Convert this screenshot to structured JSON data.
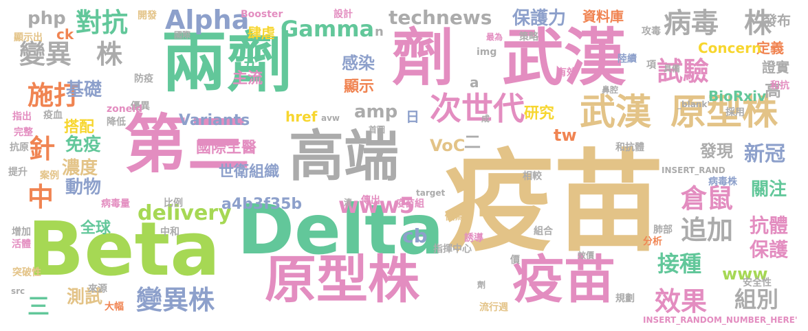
{
  "palette": {
    "tan": "#E3C387",
    "pink": "#E38DC0",
    "green": "#62C79A",
    "lime": "#A6D854",
    "orange": "#F08452",
    "blue": "#8DA0CB",
    "gray": "#ABABAB",
    "yellow": "#F7D62F"
  },
  "words": [
    {
      "text": "疫苗",
      "color": "tan"
    },
    {
      "text": "Beta",
      "color": "lime"
    },
    {
      "text": "Delta",
      "color": "green"
    },
    {
      "text": "原型株",
      "color": "pink"
    },
    {
      "text": "疫苗",
      "color": "pink"
    },
    {
      "text": "第三",
      "color": "pink"
    },
    {
      "text": "高端",
      "color": "gray"
    },
    {
      "text": "兩劑",
      "color": "green"
    },
    {
      "text": "劑",
      "color": "pink"
    },
    {
      "text": "武漢",
      "color": "pink"
    },
    {
      "text": "武漢",
      "color": "tan"
    },
    {
      "text": "原型株",
      "color": "tan"
    },
    {
      "text": "次世代",
      "color": "pink"
    },
    {
      "text": "變異",
      "color": "gray"
    },
    {
      "text": "株",
      "color": "gray"
    },
    {
      "text": "變異株",
      "color": "blue"
    },
    {
      "text": "病毒",
      "color": "gray"
    },
    {
      "text": "株",
      "color": "gray"
    },
    {
      "text": "Alpha",
      "color": "blue"
    },
    {
      "text": "Gamma",
      "color": "green"
    },
    {
      "text": "n",
      "color": "gray"
    },
    {
      "text": "technews",
      "color": "gray"
    },
    {
      "text": "對抗",
      "color": "green"
    },
    {
      "text": "施打",
      "color": "orange"
    },
    {
      "text": "基礎",
      "color": "blue"
    },
    {
      "text": "針",
      "color": "orange"
    },
    {
      "text": "免疫",
      "color": "green"
    },
    {
      "text": "中",
      "color": "orange"
    },
    {
      "text": "動物",
      "color": "blue"
    },
    {
      "text": "濃度",
      "color": "tan"
    },
    {
      "text": "delivery",
      "color": "lime"
    },
    {
      "text": "www5",
      "color": "pink"
    },
    {
      "text": "試驗",
      "color": "pink"
    },
    {
      "text": "倉鼠",
      "color": "pink"
    },
    {
      "text": "追加",
      "color": "gray"
    },
    {
      "text": "接種",
      "color": "green"
    },
    {
      "text": "效果",
      "color": "pink"
    },
    {
      "text": "組別",
      "color": "gray"
    },
    {
      "text": "測試",
      "color": "tan"
    },
    {
      "text": "三",
      "color": "green"
    },
    {
      "text": "保護力",
      "color": "blue"
    },
    {
      "text": "資料庫",
      "color": "orange"
    },
    {
      "text": "發布",
      "color": "gray"
    },
    {
      "text": "定義",
      "color": "orange"
    },
    {
      "text": "證實",
      "color": "gray"
    },
    {
      "text": "高",
      "color": "gray"
    },
    {
      "text": "新冠",
      "color": "blue"
    },
    {
      "text": "發現",
      "color": "gray"
    },
    {
      "text": "關注",
      "color": "green"
    },
    {
      "text": "抗體",
      "color": "pink"
    },
    {
      "text": "保護",
      "color": "pink"
    },
    {
      "text": "www",
      "color": "lime"
    },
    {
      "text": "cb",
      "color": "blue"
    },
    {
      "text": "Concern",
      "color": "yellow"
    },
    {
      "text": "BioRxiv",
      "color": "green"
    },
    {
      "text": "php",
      "color": "gray"
    },
    {
      "text": "ck",
      "color": "orange"
    },
    {
      "text": "五",
      "color": "green"
    },
    {
      "text": "主流",
      "color": "pink"
    },
    {
      "text": "感染",
      "color": "blue"
    },
    {
      "text": "顯示",
      "color": "orange"
    },
    {
      "text": "肆虐",
      "color": "yellow"
    },
    {
      "text": "amp",
      "color": "gray"
    },
    {
      "text": "a",
      "color": "gray"
    },
    {
      "text": "日",
      "color": "blue"
    },
    {
      "text": "搭配",
      "color": "yellow"
    },
    {
      "text": "Variants",
      "color": "blue"
    },
    {
      "text": "href",
      "color": "yellow"
    },
    {
      "text": "VoC",
      "color": "tan"
    },
    {
      "text": "二",
      "color": "gray"
    },
    {
      "text": "研究",
      "color": "yellow"
    },
    {
      "text": "tw",
      "color": "orange"
    },
    {
      "text": "國際生醫",
      "color": "pink"
    },
    {
      "text": "世衛組織",
      "color": "blue"
    },
    {
      "text": "a4b3f35b",
      "color": "blue"
    },
    {
      "text": "全球",
      "color": "green"
    },
    {
      "text": "開發",
      "color": "tan"
    },
    {
      "text": "顯示出",
      "color": "tan"
    },
    {
      "text": "國際",
      "color": "gray"
    },
    {
      "text": "策略",
      "color": "gray"
    },
    {
      "text": "最為",
      "color": "pink"
    },
    {
      "text": "img",
      "color": "gray"
    },
    {
      "text": "設計",
      "color": "pink"
    },
    {
      "text": "Booster",
      "color": "pink"
    },
    {
      "text": "陸續",
      "color": "blue"
    },
    {
      "text": "攻毒",
      "color": "gray"
    },
    {
      "text": "具備",
      "color": "gray"
    },
    {
      "text": "鼻腔",
      "color": "gray"
    },
    {
      "text": "項",
      "color": "gray"
    },
    {
      "text": "有效",
      "color": "pink"
    },
    {
      "text": "和抗",
      "color": "pink"
    },
    {
      "text": "_blank'",
      "color": "gray"
    },
    {
      "text": "採用",
      "color": "gray"
    },
    {
      "text": "和抗體",
      "color": "gray"
    },
    {
      "text": "INSERT_RAND",
      "color": "gray"
    },
    {
      "text": "病毒株",
      "color": "blue"
    },
    {
      "text": "相較",
      "color": "gray"
    },
    {
      "text": "肺部",
      "color": "gray"
    },
    {
      "text": "分析",
      "color": "orange"
    },
    {
      "text": "組合",
      "color": "gray"
    },
    {
      "text": "效價",
      "color": "gray"
    },
    {
      "text": "安全性",
      "color": "gray"
    },
    {
      "text": "規劃",
      "color": "gray"
    },
    {
      "text": "INSERT_RANDOM_NUMBER_HERE'",
      "color": "pink"
    },
    {
      "text": "誘導",
      "color": "pink"
    },
    {
      "text": "價",
      "color": "gray"
    },
    {
      "text": "流行週",
      "color": "tan"
    },
    {
      "text": "指揮中心",
      "color": "gray"
    },
    {
      "text": "做為",
      "color": "tan"
    },
    {
      "text": "疫苗組",
      "color": "pink"
    },
    {
      "text": "劑",
      "color": "gray"
    },
    {
      "text": "首圖",
      "color": "gray"
    },
    {
      "text": "成",
      "color": "gray"
    },
    {
      "text": "avw",
      "color": "gray"
    },
    {
      "text": "target",
      "color": "gray"
    },
    {
      "text": "傳出",
      "color": "pink"
    },
    {
      "text": "清",
      "color": "gray"
    },
    {
      "text": "防疫",
      "color": "gray"
    },
    {
      "text": "優異",
      "color": "gray"
    },
    {
      "text": "zoneid",
      "color": "pink"
    },
    {
      "text": "降低",
      "color": "gray"
    },
    {
      "text": "疫血",
      "color": "gray"
    },
    {
      "text": "指出",
      "color": "pink"
    },
    {
      "text": "完整",
      "color": "pink"
    },
    {
      "text": "抗原",
      "color": "gray"
    },
    {
      "text": "提升",
      "color": "gray"
    },
    {
      "text": "案例",
      "color": "tan"
    },
    {
      "text": "病毒量",
      "color": "pink"
    },
    {
      "text": "比例",
      "color": "gray"
    },
    {
      "text": "中和",
      "color": "gray"
    },
    {
      "text": "增加",
      "color": "gray"
    },
    {
      "text": "活體",
      "color": "pink"
    },
    {
      "text": "突破性",
      "color": "tan"
    },
    {
      "text": "src",
      "color": "gray"
    },
    {
      "text": "來源",
      "color": "gray"
    },
    {
      "text": "大幅",
      "color": "orange"
    }
  ]
}
